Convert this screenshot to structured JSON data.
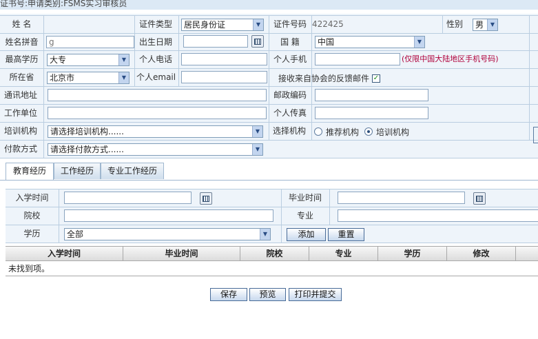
{
  "header": {
    "title": "证书号:申请类别:FSMS实习审核员"
  },
  "form": {
    "name_label": "姓 名",
    "name_value": "",
    "id_type_label": "证件类型",
    "id_type_value": "居民身份证",
    "id_no_label": "证件号码",
    "id_no_value": "422425",
    "gender_label": "性别",
    "gender_value": "男",
    "pinyin_label": "姓名拼音",
    "pinyin_value": "g",
    "birth_label": "出生日期",
    "birth_value": "",
    "nationality_label": "国 籍",
    "nationality_value": "中国",
    "education_label": "最高学历",
    "education_value": "大专",
    "phone_label": "个人电话",
    "phone_value": "",
    "mobile_label": "个人手机",
    "mobile_value": "",
    "mobile_note": "(仅限中国大陆地区手机号码)",
    "province_label": "所在省",
    "province_value": "北京市",
    "email_label": "个人email",
    "email_value": "",
    "feedback_label": "接收来自协会的反馈邮件",
    "feedback_checked": true,
    "address_label": "通讯地址",
    "address_value": "",
    "postcode_label": "邮政编码",
    "postcode_value": "",
    "employer_label": "工作单位",
    "employer_value": "",
    "fax_label": "个人传真",
    "fax_value": "",
    "training_label": "培训机构",
    "training_value": "请选择培训机构......",
    "choose_org_label": "选择机构",
    "radio_recommend": "推荐机构",
    "radio_training": "培训机构",
    "radio_selected": "培训机构",
    "payment_label": "付款方式",
    "payment_value": "请选择付款方式......"
  },
  "tabs": [
    {
      "label": "教育经历",
      "active": true
    },
    {
      "label": "工作经历",
      "active": false
    },
    {
      "label": "专业工作经历",
      "active": false
    }
  ],
  "education": {
    "start_label": "入学时间",
    "start_value": "",
    "end_label": "毕业时间",
    "end_value": "",
    "school_label": "院校",
    "school_value": "",
    "major_label": "专业",
    "major_value": "",
    "degree_label": "学历",
    "degree_value": "全部",
    "add_button": "添加",
    "reset_button": "重置"
  },
  "grid": {
    "columns": [
      "入学时间",
      "毕业时间",
      "院校",
      "专业",
      "学历",
      "修改"
    ],
    "empty_text": "未找到项。"
  },
  "footer": {
    "save_button": "保存",
    "preview_button": "预览",
    "print_submit_button": "打印并提交"
  }
}
